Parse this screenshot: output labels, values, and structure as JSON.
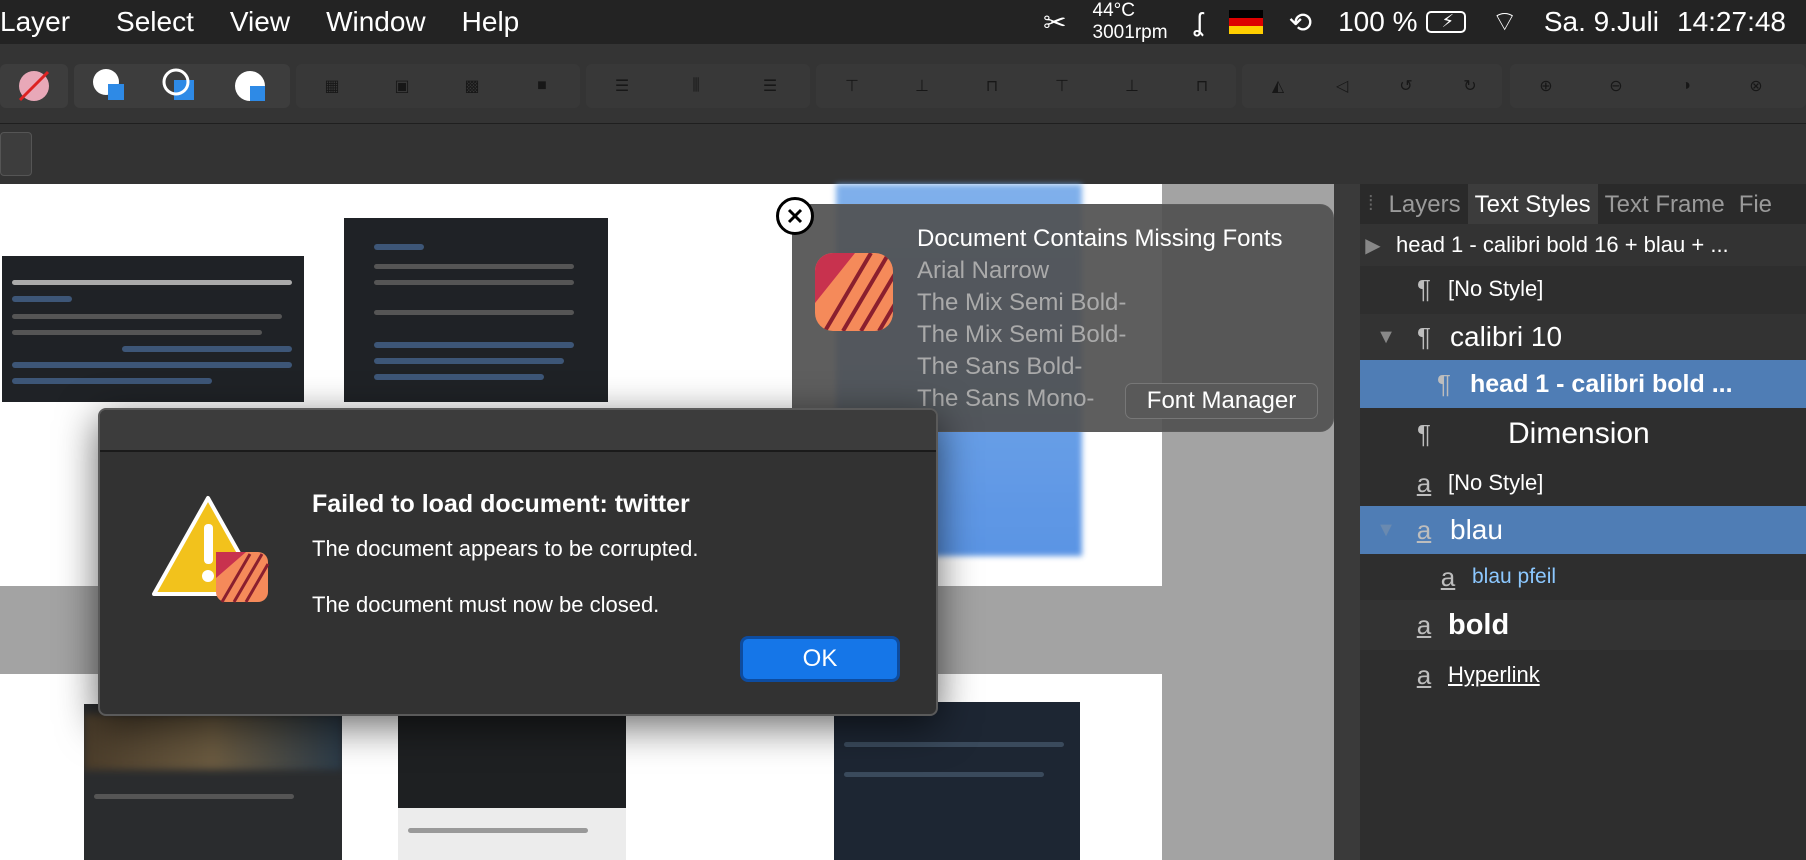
{
  "menubar": {
    "items": [
      "Layer",
      "Select",
      "View",
      "Window",
      "Help"
    ],
    "temp": "44°C",
    "rpm": "3001rpm",
    "battery": "100 %",
    "date": "Sa. 9.Juli",
    "time": "14:27:48"
  },
  "panel": {
    "tabs": [
      "Layers",
      "Text Styles",
      "Text Frame",
      "Fie"
    ],
    "rows": [
      {
        "label": "head 1 - calibri bold 16 + blau + ..."
      },
      {
        "label": "[No Style]"
      },
      {
        "label": "calibri 10"
      },
      {
        "label": "head 1 - calibri bold ..."
      },
      {
        "label": "Dimension"
      },
      {
        "label": "[No Style]"
      },
      {
        "label": "blau"
      },
      {
        "label": "blau pfeil"
      },
      {
        "label": "bold"
      },
      {
        "label": "Hyperlink"
      }
    ]
  },
  "notification": {
    "title": "Document Contains Missing Fonts",
    "fonts": [
      "Arial Narrow",
      "The Mix Semi Bold-",
      "The Mix Semi Bold-",
      "The Sans Bold-",
      "The Sans Mono-"
    ],
    "button": "Font Manager"
  },
  "dialog": {
    "heading": "Failed to load document: twitter",
    "message1": "The document appears to be corrupted.",
    "message2": "The document must now be closed.",
    "ok": "OK"
  },
  "colors": {
    "accent": "#1576e8",
    "selection": "#4f7db5",
    "app_icon": "#f58a5a"
  }
}
